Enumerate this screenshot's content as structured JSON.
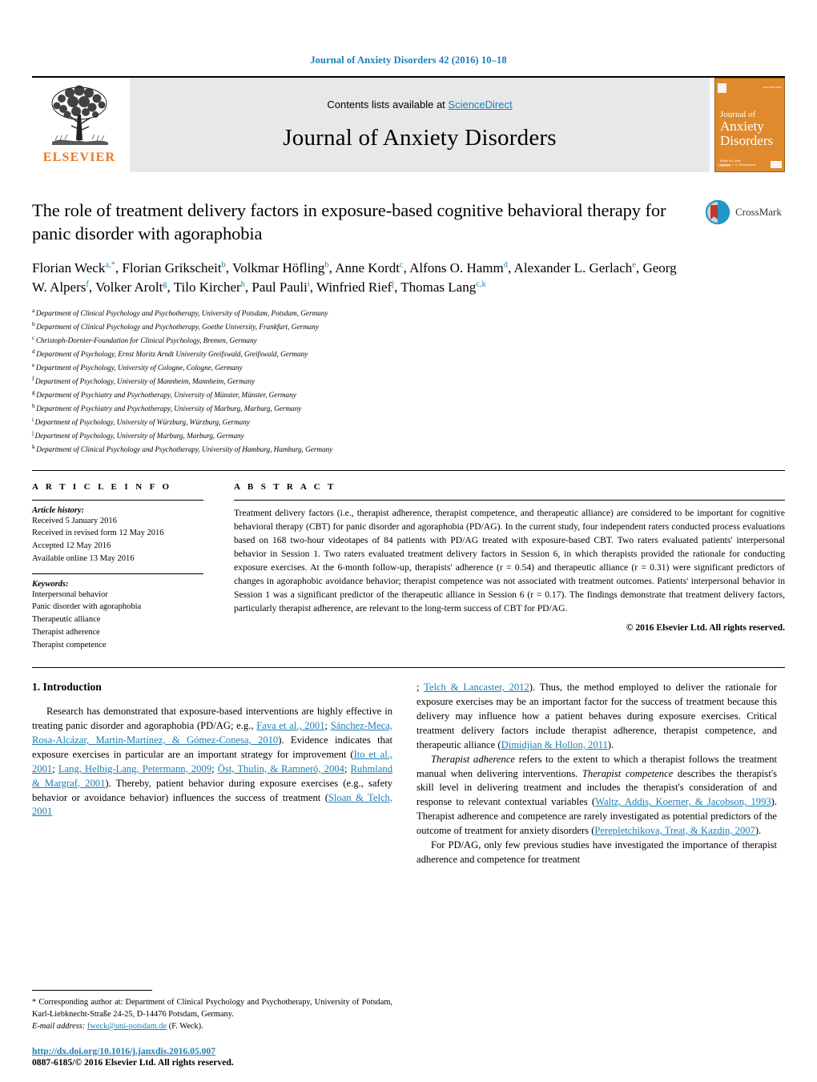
{
  "running_head": "Journal of Anxiety Disorders 42 (2016) 10–18",
  "masthead": {
    "contents_prefix": "Contents lists available at ",
    "sciencedirect": "ScienceDirect",
    "journal_name": "Journal of Anxiety Disorders",
    "publisher_name": "ELSEVIER",
    "publisher_logo_icon": "elsevier-tree-icon",
    "cover": {
      "line1": "Anxiety",
      "line2": "Disorders",
      "prefix_small": "Journal of",
      "accent_color": "#E08A2E",
      "footer_note": "ELSEVIER"
    }
  },
  "article": {
    "title": "The role of treatment delivery factors in exposure-based cognitive behavioral therapy for panic disorder with agoraphobia",
    "crossmark_label": "CrossMark",
    "crossmark_icon": "crossmark-logo-icon",
    "authors": [
      {
        "name": "Florian Weck",
        "marks": "a,*"
      },
      {
        "name": "Florian Grikscheit",
        "marks": "b"
      },
      {
        "name": "Volkmar Höfling",
        "marks": "b"
      },
      {
        "name": "Anne Kordt",
        "marks": "c"
      },
      {
        "name": "Alfons O. Hamm",
        "marks": "d"
      },
      {
        "name": "Alexander L. Gerlach",
        "marks": "e"
      },
      {
        "name": "Georg W. Alpers",
        "marks": "f"
      },
      {
        "name": "Volker Arolt",
        "marks": "g"
      },
      {
        "name": "Tilo Kircher",
        "marks": "h"
      },
      {
        "name": "Paul Pauli",
        "marks": "i"
      },
      {
        "name": "Winfried Rief",
        "marks": "j"
      },
      {
        "name": "Thomas Lang",
        "marks": "c,k"
      }
    ],
    "affiliations": [
      {
        "mark": "a",
        "text": "Department of Clinical Psychology and Psychotherapy, University of Potsdam, Potsdam, Germany"
      },
      {
        "mark": "b",
        "text": "Department of Clinical Psychology and Psychotherapy, Goethe University, Frankfurt, Germany"
      },
      {
        "mark": "c",
        "text": "Christoph-Dornier-Foundation for Clinical Psychology, Bremen, Germany"
      },
      {
        "mark": "d",
        "text": "Department of Psychology, Ernst Moritz Arndt University Greifswald, Greifswald, Germany"
      },
      {
        "mark": "e",
        "text": "Department of Psychology, University of Cologne, Cologne, Germany"
      },
      {
        "mark": "f",
        "text": "Department of Psychology, University of Mannheim, Mannheim, Germany"
      },
      {
        "mark": "g",
        "text": "Department of Psychiatry and Psychotherapy, University of Münster, Münster, Germany"
      },
      {
        "mark": "h",
        "text": "Department of Psychiatry and Psychotherapy, University of Marburg, Marburg, Germany"
      },
      {
        "mark": "i",
        "text": "Department of Psychology, University of Würzburg, Würzburg, Germany"
      },
      {
        "mark": "j",
        "text": "Department of Psychology, University of Marburg, Marburg, Germany"
      },
      {
        "mark": "k",
        "text": "Department of Clinical Psychology and Psychotherapy, University of Hamburg, Hamburg, Germany"
      }
    ]
  },
  "article_info": {
    "heading": "A R T I C L E   I N F O",
    "history_label": "Article history:",
    "history": [
      "Received 5 January 2016",
      "Received in revised form 12 May 2016",
      "Accepted 12 May 2016",
      "Available online 13 May 2016"
    ],
    "keywords_label": "Keywords:",
    "keywords": [
      "Interpersonal behavior",
      "Panic disorder with agoraphobia",
      "Therapeutic alliance",
      "Therapist adherence",
      "Therapist competence"
    ]
  },
  "abstract": {
    "heading": "A B S T R A C T",
    "paragraph": "Treatment delivery factors (i.e., therapist adherence, therapist competence, and therapeutic alliance) are considered to be important for cognitive behavioral therapy (CBT) for panic disorder and agoraphobia (PD/AG). In the current study, four independent raters conducted process evaluations based on 168 two-hour videotapes of 84 patients with PD/AG treated with exposure-based CBT. Two raters evaluated patients' interpersonal behavior in Session 1. Two raters evaluated treatment delivery factors in Session 6, in which therapists provided the rationale for conducting exposure exercises. At the 6-month follow-up, therapists' adherence (r = 0.54) and therapeutic alliance (r = 0.31) were significant predictors of changes in agoraphobic avoidance behavior; therapist competence was not associated with treatment outcomes. Patients' interpersonal behavior in Session 1 was a significant predictor of the therapeutic alliance in Session 6 (r = 0.17). The findings demonstrate that treatment delivery factors, particularly therapist adherence, are relevant to the long-term success of CBT for PD/AG.",
    "copyright": "© 2016 Elsevier Ltd. All rights reserved."
  },
  "introduction": {
    "heading": "1.  Introduction",
    "left_p1_a": "Research has demonstrated that exposure-based interventions are highly effective in treating panic disorder and agoraphobia (PD/AG; e.g., ",
    "left_p1_cite1": "Fava et al., 2001",
    "left_p1_b": "; ",
    "left_p1_cite2": "Sánchez-Meca, Rosa-Alcázar, Martin-Martínez, & Gómez-Conesa, 2010",
    "left_p1_c": "). Evidence indicates that exposure exercises in particular are an important strategy for improvement (",
    "left_p1_cite3": "Ito et al., 2001",
    "left_p1_d": "; ",
    "left_p1_cite4": "Lang, Helbig-Lang, Petermann, 2009",
    "left_p1_e": "; ",
    "left_p1_cite5": "Öst, Thulin, & Ramnerö, 2004",
    "left_p1_f": "; ",
    "left_p1_cite6": "Ruhmland & Margraf, 2001",
    "left_p1_g": "). Thereby, patient behavior during exposure exercises (e.g., safety behavior or avoidance behavior) influences the success of treatment (",
    "left_p1_cite7": "Sloan & Telch, 2001",
    "left_p1_h": "; ",
    "left_p1_cite8": "Telch & Lancaster, 2012",
    "right_p1_tail": "). Thus, the method employed to deliver the rationale for exposure exercises may be an important factor for the success of treatment because this delivery may influence how a patient behaves during exposure exercises. Critical treatment delivery factors include therapist adherence, therapist competence, and therapeutic alliance (",
    "right_p1_cite": "Dimidjian & Hollon, 2011",
    "right_p1_end": ").",
    "right_p2_ital1": "Therapist adherence",
    "right_p2_a": " refers to the extent to which a therapist follows the treatment manual when delivering interventions. ",
    "right_p2_ital2": "Therapist competence",
    "right_p2_b": " describes the therapist's skill level in delivering treatment and includes the therapist's consideration of and response to relevant contextual variables (",
    "right_p2_cite1": "Waltz, Addis, Koerner, & Jacobson, 1993",
    "right_p2_c": "). Therapist adherence and competence are rarely investigated as potential predictors of the outcome of treatment for anxiety disorders (",
    "right_p2_cite2": "Perepletchikova, Treat, & Kazdin, 2007",
    "right_p2_d": ").",
    "right_p3": "For PD/AG, only few previous studies have investigated the importance of therapist adherence and competence for treatment"
  },
  "footnote": {
    "marker": "*",
    "corresponding_a": " Corresponding author at: Department of Clinical Psychology and Psychotherapy, University of Potsdam, Karl-Liebknecht-Straße 24-25, D-14476 Potsdam, Germany.",
    "email_label": "E-mail address:",
    "email": "fweck@uni-potsdam.de",
    "email_suffix": " (F. Weck)."
  },
  "footer": {
    "doi": "http://dx.doi.org/10.1016/j.janxdis.2016.05.007",
    "issn": "0887-6185/© 2016 Elsevier Ltd. All rights reserved."
  },
  "colors": {
    "link_blue": "#1b7fb5",
    "elsevier_orange": "#E87722",
    "masthead_gray": "#e7e8ea"
  }
}
